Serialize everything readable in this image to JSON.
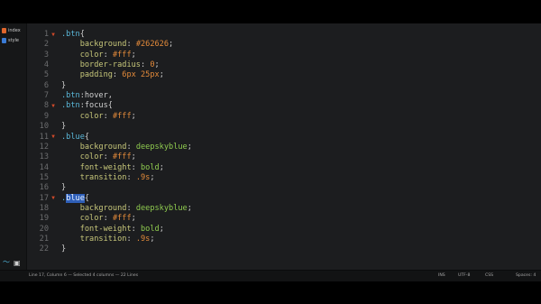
{
  "sidebar": {
    "files": [
      {
        "name": "index",
        "color": "#e0662c"
      },
      {
        "name": "style",
        "color": "#3a7bd5"
      }
    ]
  },
  "editor": {
    "lines": [
      {
        "n": "1",
        "fold": true,
        "tokens": [
          {
            "t": "sel",
            "v": ".btn"
          },
          {
            "t": "punct",
            "v": "{"
          }
        ]
      },
      {
        "n": "2",
        "fold": false,
        "tokens": [
          {
            "t": "ws",
            "v": "    "
          },
          {
            "t": "prop",
            "v": "background"
          },
          {
            "t": "punct",
            "v": ": "
          },
          {
            "t": "num",
            "v": "#262626"
          },
          {
            "t": "punct",
            "v": ";"
          }
        ]
      },
      {
        "n": "3",
        "fold": false,
        "tokens": [
          {
            "t": "ws",
            "v": "    "
          },
          {
            "t": "prop",
            "v": "color"
          },
          {
            "t": "punct",
            "v": ": "
          },
          {
            "t": "num",
            "v": "#fff"
          },
          {
            "t": "punct",
            "v": ";"
          }
        ]
      },
      {
        "n": "4",
        "fold": false,
        "tokens": [
          {
            "t": "ws",
            "v": "    "
          },
          {
            "t": "prop",
            "v": "border-radius"
          },
          {
            "t": "punct",
            "v": ": "
          },
          {
            "t": "num",
            "v": "0"
          },
          {
            "t": "punct",
            "v": ";"
          }
        ]
      },
      {
        "n": "5",
        "fold": false,
        "tokens": [
          {
            "t": "ws",
            "v": "    "
          },
          {
            "t": "prop",
            "v": "padding"
          },
          {
            "t": "punct",
            "v": ": "
          },
          {
            "t": "num",
            "v": "6px 25px"
          },
          {
            "t": "punct",
            "v": ";"
          }
        ]
      },
      {
        "n": "6",
        "fold": false,
        "tokens": [
          {
            "t": "punct",
            "v": "}"
          }
        ]
      },
      {
        "n": "7",
        "fold": false,
        "tokens": [
          {
            "t": "sel",
            "v": ".btn"
          },
          {
            "t": "pseudo",
            "v": ":hover,"
          }
        ]
      },
      {
        "n": "8",
        "fold": true,
        "tokens": [
          {
            "t": "sel",
            "v": ".btn"
          },
          {
            "t": "pseudo",
            "v": ":focus"
          },
          {
            "t": "punct",
            "v": "{"
          }
        ]
      },
      {
        "n": "9",
        "fold": false,
        "tokens": [
          {
            "t": "ws",
            "v": "    "
          },
          {
            "t": "prop",
            "v": "color"
          },
          {
            "t": "punct",
            "v": ": "
          },
          {
            "t": "num",
            "v": "#fff"
          },
          {
            "t": "punct",
            "v": ";"
          }
        ]
      },
      {
        "n": "10",
        "fold": false,
        "tokens": [
          {
            "t": "punct",
            "v": "}"
          }
        ]
      },
      {
        "n": "11",
        "fold": true,
        "tokens": [
          {
            "t": "cls",
            "v": ".blue"
          },
          {
            "t": "punct",
            "v": "{"
          }
        ]
      },
      {
        "n": "12",
        "fold": false,
        "tokens": [
          {
            "t": "ws",
            "v": "    "
          },
          {
            "t": "prop",
            "v": "background"
          },
          {
            "t": "punct",
            "v": ": "
          },
          {
            "t": "val",
            "v": "deepskyblue"
          },
          {
            "t": "punct",
            "v": ";"
          }
        ]
      },
      {
        "n": "13",
        "fold": false,
        "tokens": [
          {
            "t": "ws",
            "v": "    "
          },
          {
            "t": "prop",
            "v": "color"
          },
          {
            "t": "punct",
            "v": ": "
          },
          {
            "t": "num",
            "v": "#fff"
          },
          {
            "t": "punct",
            "v": ";"
          }
        ]
      },
      {
        "n": "14",
        "fold": false,
        "tokens": [
          {
            "t": "ws",
            "v": "    "
          },
          {
            "t": "prop",
            "v": "font-weight"
          },
          {
            "t": "punct",
            "v": ": "
          },
          {
            "t": "val",
            "v": "bold"
          },
          {
            "t": "punct",
            "v": ";"
          }
        ]
      },
      {
        "n": "15",
        "fold": false,
        "tokens": [
          {
            "t": "ws",
            "v": "    "
          },
          {
            "t": "prop",
            "v": "transition"
          },
          {
            "t": "punct",
            "v": ": "
          },
          {
            "t": "num",
            "v": ".9s"
          },
          {
            "t": "punct",
            "v": ";"
          }
        ]
      },
      {
        "n": "16",
        "fold": false,
        "tokens": [
          {
            "t": "punct",
            "v": "}"
          }
        ]
      },
      {
        "n": "17",
        "fold": true,
        "tokens": [
          {
            "t": "cls",
            "v": "."
          },
          {
            "t": "hl",
            "v": "blue"
          },
          {
            "t": "punct",
            "v": "{"
          }
        ]
      },
      {
        "n": "18",
        "fold": false,
        "tokens": [
          {
            "t": "ws",
            "v": "    "
          },
          {
            "t": "prop",
            "v": "background"
          },
          {
            "t": "punct",
            "v": ": "
          },
          {
            "t": "val",
            "v": "deepskyblue"
          },
          {
            "t": "punct",
            "v": ";"
          }
        ]
      },
      {
        "n": "19",
        "fold": false,
        "tokens": [
          {
            "t": "ws",
            "v": "    "
          },
          {
            "t": "prop",
            "v": "color"
          },
          {
            "t": "punct",
            "v": ": "
          },
          {
            "t": "num",
            "v": "#fff"
          },
          {
            "t": "punct",
            "v": ";"
          }
        ]
      },
      {
        "n": "20",
        "fold": false,
        "tokens": [
          {
            "t": "ws",
            "v": "    "
          },
          {
            "t": "prop",
            "v": "font-weight"
          },
          {
            "t": "punct",
            "v": ": "
          },
          {
            "t": "val",
            "v": "bold"
          },
          {
            "t": "punct",
            "v": ";"
          }
        ]
      },
      {
        "n": "21",
        "fold": false,
        "tokens": [
          {
            "t": "ws",
            "v": "    "
          },
          {
            "t": "prop",
            "v": "transition"
          },
          {
            "t": "punct",
            "v": ": "
          },
          {
            "t": "num",
            "v": ".9s"
          },
          {
            "t": "punct",
            "v": ";"
          }
        ]
      },
      {
        "n": "22",
        "fold": false,
        "tokens": [
          {
            "t": "punct",
            "v": "}"
          }
        ]
      }
    ]
  },
  "statusbar": {
    "left": "Line 17, Column 6 — Selected 4 columns — 22 Lines",
    "mode": "INS",
    "encoding": "UTF-8",
    "syntax": "CSS",
    "indent": "Spaces: 4"
  },
  "colors": {
    "background": "#1c1d1f",
    "selection": "#2f5fb8",
    "fold_arrow": "#d14a2a"
  }
}
